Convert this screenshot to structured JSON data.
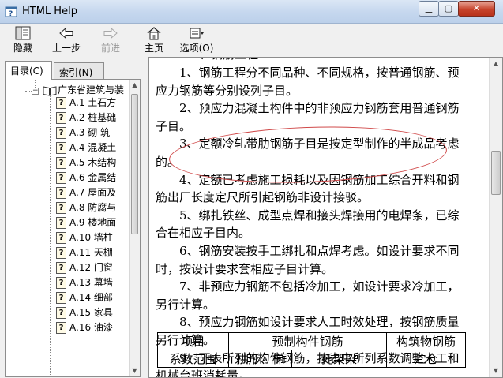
{
  "window": {
    "title": "HTML Help"
  },
  "toolbar": {
    "hide": "隐藏",
    "back": "上一步",
    "forward": "前进",
    "home": "主页",
    "options": "选项(O)"
  },
  "tabs": {
    "contents": "目录(C)",
    "index": "索引(N)"
  },
  "tree": {
    "root": "广东省建筑与装",
    "items": [
      {
        "label": "A.1  土石方"
      },
      {
        "label": "A.2  桩基础"
      },
      {
        "label": "A.3  砌  筑"
      },
      {
        "label": "A.4  混凝土"
      },
      {
        "label": "A.5  木结构"
      },
      {
        "label": "A.6  金属结"
      },
      {
        "label": "A.7  屋面及"
      },
      {
        "label": "A.8  防腐与"
      },
      {
        "label": "A.9  楼地面"
      },
      {
        "label": "A.10  墙柱"
      },
      {
        "label": "A.11  天棚"
      },
      {
        "label": "A.12  门窗"
      },
      {
        "label": "A.13  幕墙"
      },
      {
        "label": "A.14  细部"
      },
      {
        "label": "A.15  家具"
      },
      {
        "label": "A.16  油漆"
      }
    ]
  },
  "content": {
    "cut_top": "一、钢筋工程",
    "paragraphs": [
      "　　1、钢筋工程分不同品种、不同规格，按普通钢筋、预应力钢筋等分别设列子目。",
      "　　2、预应力混凝土构件中的非预应力钢筋套用普通钢筋子目。",
      "　　3、定额冷轧带肋钢筋子目是按定型制作的半成品考虑的。",
      "　　4、定额已考虑施工损耗以及因钢筋加工综合开料和钢筋出厂长度定尺所引起钢筋非设计接驳。",
      "　　5、绑扎铁丝、成型点焊和接头焊接用的电焊条，已综合在相应子目内。",
      "　　6、钢筋安装按手工绑扎和点焊考虑。如设计要求不同时，按设计要求套相应子目计算。",
      "　　7、非预应力钢筋不包括冷加工，如设计要求冷加工，另行计算。",
      "　　8、预应力钢筋如设计要求人工时效处理，按钢筋质量另行计算。",
      "　　9、下表所列的构件钢筋，按表中所列系数调整人工和机械台班消耗量。"
    ],
    "table": {
      "headers": [
        "项目",
        "预制构件钢筋",
        "构筑物钢筋"
      ],
      "row2": [
        "系数范围",
        "拱形、梯",
        "托架梁",
        "贮仓"
      ]
    }
  }
}
